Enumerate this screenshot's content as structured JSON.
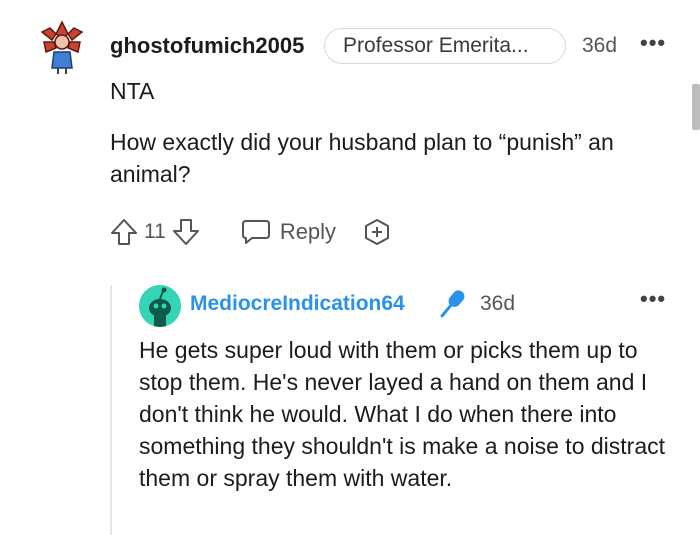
{
  "comment": {
    "username": "ghostofumich2005",
    "flair": "Professor Emerita...",
    "time": "36d",
    "more_label": "•••",
    "lines": [
      "NTA",
      "How exactly did your husband plan to “punish” an animal?"
    ],
    "vote_count": "11",
    "reply_label": "Reply",
    "icons": {
      "upvote": "upvote-arrow-icon",
      "downvote": "downvote-arrow-icon",
      "reply": "speech-bubble-icon",
      "award": "award-plus-icon"
    }
  },
  "reply": {
    "username": "MediocreIndication64",
    "time": "36d",
    "more_label": "•••",
    "text": "He gets super loud with them or picks them up to stop them. He's never layed a hand on them and I don't think he would. What I do when there into something they shouldn't is make a noise to distract them or spray them with water.",
    "icons": {
      "badge": "microphone-icon",
      "avatar": "snoo-avatar"
    }
  },
  "colors": {
    "reply_username": "#2a93e8",
    "reply_avatar_bg": "#35d4b6",
    "avatar_main_red": "#c9432f",
    "avatar_main_blue": "#3f7fd4"
  }
}
